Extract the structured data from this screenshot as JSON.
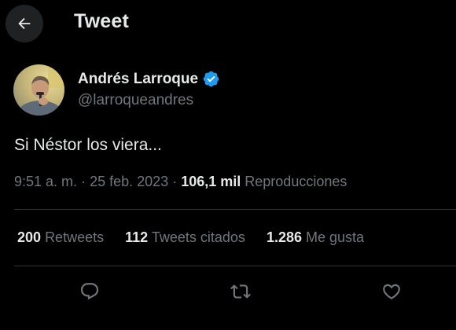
{
  "header": {
    "title": "Tweet",
    "back_icon": "arrow-left-icon"
  },
  "author": {
    "name": "Andrés Larroque",
    "handle": "@larroqueandres",
    "verified": true,
    "verified_color": "#1d9bf0"
  },
  "tweet": {
    "text": "Si Néstor los viera...",
    "time": "9:51 a. m.",
    "date": "25 feb. 2023",
    "separator": "·",
    "views_count": "106,1 mil",
    "views_label": "Reproducciones"
  },
  "stats": {
    "retweets_count": "200",
    "retweets_label": "Retweets",
    "quotes_count": "112",
    "quotes_label": "Tweets citados",
    "likes_count": "1.286",
    "likes_label": "Me gusta"
  },
  "actions": [
    {
      "icon": "reply-icon"
    },
    {
      "icon": "retweet-icon"
    },
    {
      "icon": "like-icon"
    }
  ],
  "colors": {
    "background": "#000000",
    "primary_text": "#e7e9ea",
    "secondary_text": "#71767b",
    "divider": "#2f3336",
    "accent": "#1d9bf0"
  }
}
